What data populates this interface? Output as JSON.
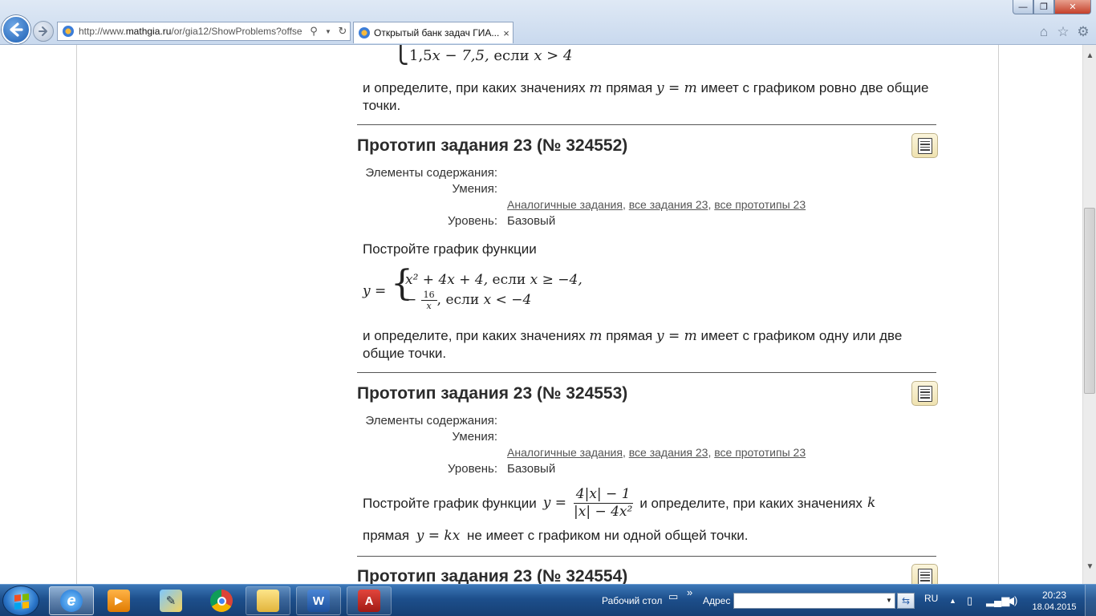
{
  "browser": {
    "address_url_prefix": "http://www.",
    "address_url_domain": "mathgia.ru",
    "address_url_path": "/or/gia12/ShowProblems?offse",
    "tab_title": "Открытый банк задач ГИА...",
    "tab_close": "×",
    "min_glyph": "—",
    "max_glyph": "❐",
    "close_glyph": "✕"
  },
  "page": {
    "top_case": {
      "value": "1,5",
      "mid": "x − 7,5,",
      "cond": "если",
      "rel": "x > 4"
    },
    "top_text": {
      "pre": "и определите, при каких значениях",
      "m": "m",
      "mid": "прямая",
      "eq": "y = m",
      "post": "имеет с графиком ровно две общие точки."
    },
    "problems": [
      {
        "title": "Прототип задания 23 (№ 324552)",
        "elements_label": "Элементы содержания:",
        "skills_label": "Умения:",
        "link_similar": "Аналогичные задания",
        "link_all": "все задания 23",
        "link_protos": "все прототипы 23",
        "level_label": "Уровень:",
        "level_value": "Базовый",
        "intro": "Постройте график функции",
        "formula": {
          "lhs": "y =",
          "case1": "x² + 4x + 4,",
          "case1_cond": "если",
          "case1_rel": "x ≥ −4,",
          "case2_sign": "−",
          "case2_num": "16",
          "case2_den": "x",
          "case2_cond": "если",
          "case2_rel": "x < −4"
        },
        "q_pre": "и определите, при каких значениях",
        "q_m": "m",
        "q_mid": "прямая",
        "q_eq": "y = m",
        "q_post": "имеет с графиком одну или две общие точки."
      },
      {
        "title": "Прототип задания 23 (№ 324553)",
        "elements_label": "Элементы содержания:",
        "skills_label": "Умения:",
        "link_similar": "Аналогичные задания",
        "link_all": "все задания 23",
        "link_protos": "все прототипы 23",
        "level_label": "Уровень:",
        "level_value": "Базовый",
        "intro": "Постройте график функции",
        "formula": {
          "lhs": "y =",
          "num": "4|x| − 1",
          "den": "|x| − 4x²"
        },
        "q_mid": "и определите, при каких значениях",
        "q_k": "k",
        "q_line": "прямая",
        "q_eq": "y = kx",
        "q_post": "не имеет с графиком ни одной общей точки."
      },
      {
        "title": "Прототип задания 23 (№ 324554)"
      }
    ]
  },
  "taskbar": {
    "desktop_label": "Рабочий стол",
    "chevron": "»",
    "address_label": "Адрес",
    "lang": "RU",
    "time": "20:23",
    "date": "18.04.2015"
  }
}
